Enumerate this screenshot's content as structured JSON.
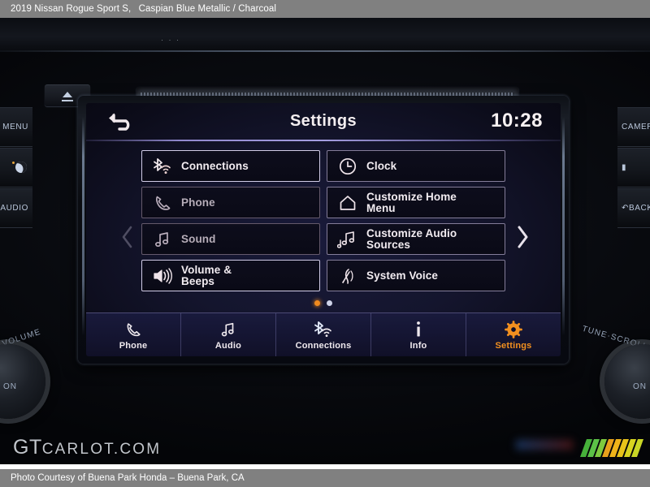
{
  "caption": {
    "model": "2019 Nissan Rogue Sport S,",
    "colors": "Caspian Blue Metallic / Charcoal"
  },
  "footer": {
    "credit": "Photo Courtesy of Buena Park Honda – Buena Park, CA"
  },
  "watermark": {
    "part1": "GT",
    "part2": "CARLOT.COM"
  },
  "dashboard": {
    "eject_label": "eject-button",
    "left_buttons": [
      {
        "label": "MENU",
        "icon": "none"
      },
      {
        "label": "",
        "icon": "day-night"
      },
      {
        "label": "AUDIO",
        "icon": "none"
      }
    ],
    "right_buttons": [
      {
        "label": "CAMERA",
        "icon": "none"
      },
      {
        "label": "",
        "icon": "none"
      },
      {
        "label": "BACK",
        "icon": "back"
      }
    ],
    "left_knob_label": "VOLUME",
    "left_knob_inner": "ON",
    "right_knob_label": "TUNE·SCROLL",
    "right_knob_inner": "ON"
  },
  "screen": {
    "title": "Settings",
    "clock": "10:28",
    "back_icon": "back-arrow-icon",
    "prev_arrow": "chevron-left-icon",
    "next_arrow": "chevron-right-icon",
    "tiles": [
      {
        "label": "Connections",
        "label2": "",
        "icon": "bluetooth-wifi-icon",
        "state": "bright"
      },
      {
        "label": "Clock",
        "label2": "",
        "icon": "clock-icon",
        "state": "normal"
      },
      {
        "label": "Phone",
        "label2": "",
        "icon": "phone-handset-icon",
        "state": "dim"
      },
      {
        "label": "Customize Home",
        "label2": "Menu",
        "icon": "home-icon",
        "state": "normal"
      },
      {
        "label": "Sound",
        "label2": "",
        "icon": "music-note-icon",
        "state": "dim"
      },
      {
        "label": "Customize Audio",
        "label2": "Sources",
        "icon": "music-notes-icon",
        "state": "normal"
      },
      {
        "label": "Volume &",
        "label2": "Beeps",
        "icon": "speaker-icon",
        "state": "bright"
      },
      {
        "label": "System Voice",
        "label2": "",
        "icon": "voice-icon",
        "state": "normal"
      }
    ],
    "page_dots": [
      {
        "state": "active"
      },
      {
        "state": "idle"
      }
    ],
    "nav": [
      {
        "label": "Phone",
        "icon": "phone-handset-icon",
        "active": false
      },
      {
        "label": "Audio",
        "icon": "music-note-icon",
        "active": false
      },
      {
        "label": "Connections",
        "icon": "bluetooth-wifi-icon",
        "active": false
      },
      {
        "label": "Info",
        "icon": "info-icon",
        "active": false
      },
      {
        "label": "Settings",
        "icon": "gear-icon",
        "active": true
      }
    ]
  },
  "colors": {
    "accent_orange": "#f2901f",
    "caption_bg": "#808080",
    "screen_text": "#f2ecf1",
    "tile_border": "#cec4e8"
  }
}
